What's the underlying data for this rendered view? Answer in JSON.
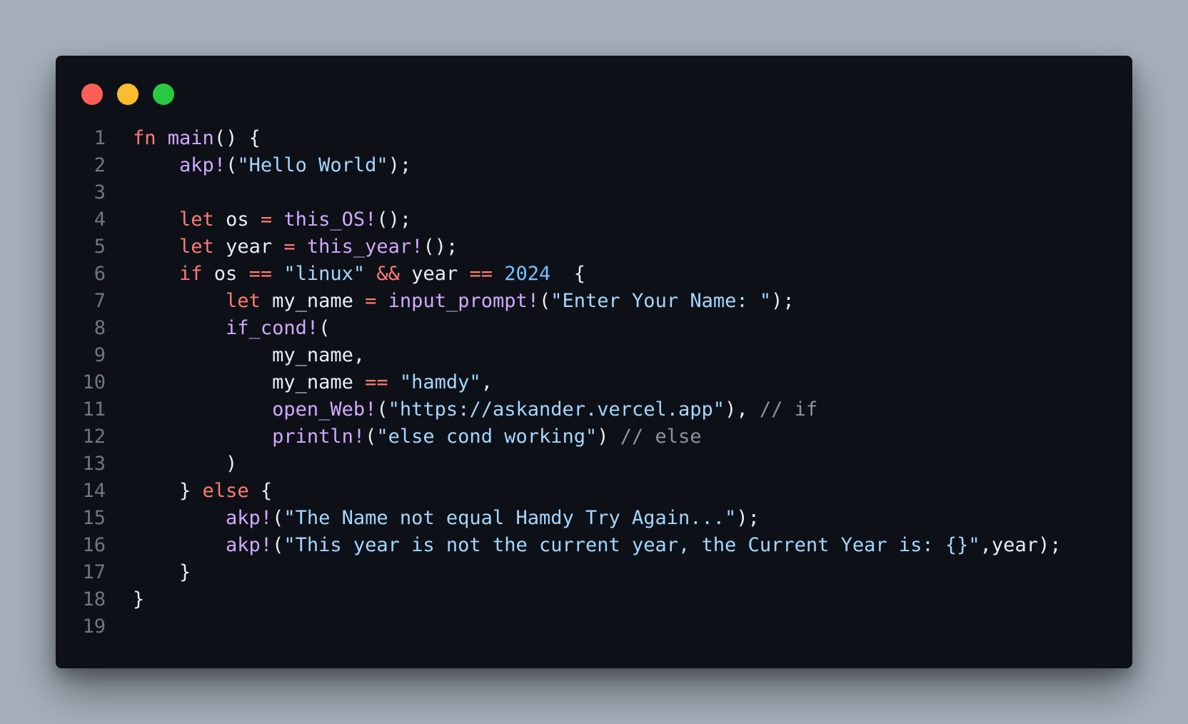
{
  "colors": {
    "background": "#a6b0bb",
    "window": "#0d1117",
    "line_number": "#6e7681",
    "keyword": "#ff7b72",
    "function": "#d2a8ff",
    "string": "#a5d6ff",
    "number": "#79c0ff",
    "comment": "#8b949e",
    "plain": "#e6edf3"
  },
  "window_controls": [
    {
      "name": "close-dot",
      "color": "#ff5f57"
    },
    {
      "name": "minimize-dot",
      "color": "#febc2e"
    },
    {
      "name": "zoom-dot",
      "color": "#28c840"
    }
  ],
  "lines": [
    {
      "n": "1",
      "tokens": [
        [
          "kw",
          "fn"
        ],
        [
          "pl",
          " "
        ],
        [
          "fn",
          "main"
        ],
        [
          "pl",
          "() {"
        ]
      ]
    },
    {
      "n": "2",
      "tokens": [
        [
          "pl",
          "    "
        ],
        [
          "fn",
          "akp!"
        ],
        [
          "pl",
          "("
        ],
        [
          "str",
          "\"Hello World\""
        ],
        [
          "pl",
          ");"
        ]
      ]
    },
    {
      "n": "3",
      "tokens": []
    },
    {
      "n": "4",
      "tokens": [
        [
          "pl",
          "    "
        ],
        [
          "kw",
          "let"
        ],
        [
          "pl",
          " os "
        ],
        [
          "op",
          "="
        ],
        [
          "pl",
          " "
        ],
        [
          "fn",
          "this_OS!"
        ],
        [
          "pl",
          "();"
        ]
      ]
    },
    {
      "n": "5",
      "tokens": [
        [
          "pl",
          "    "
        ],
        [
          "kw",
          "let"
        ],
        [
          "pl",
          " year "
        ],
        [
          "op",
          "="
        ],
        [
          "pl",
          " "
        ],
        [
          "fn",
          "this_year!"
        ],
        [
          "pl",
          "();"
        ]
      ]
    },
    {
      "n": "6",
      "tokens": [
        [
          "pl",
          "    "
        ],
        [
          "kw",
          "if"
        ],
        [
          "pl",
          " os "
        ],
        [
          "op",
          "=="
        ],
        [
          "pl",
          " "
        ],
        [
          "str",
          "\"linux\""
        ],
        [
          "pl",
          " "
        ],
        [
          "op",
          "&&"
        ],
        [
          "pl",
          " year "
        ],
        [
          "op",
          "=="
        ],
        [
          "pl",
          " "
        ],
        [
          "num",
          "2024"
        ],
        [
          "pl",
          "  {"
        ]
      ]
    },
    {
      "n": "7",
      "tokens": [
        [
          "pl",
          "        "
        ],
        [
          "kw",
          "let"
        ],
        [
          "pl",
          " my_name "
        ],
        [
          "op",
          "="
        ],
        [
          "pl",
          " "
        ],
        [
          "fn",
          "input_prompt!"
        ],
        [
          "pl",
          "("
        ],
        [
          "str",
          "\"Enter Your Name: \""
        ],
        [
          "pl",
          ");"
        ]
      ]
    },
    {
      "n": "8",
      "tokens": [
        [
          "pl",
          "        "
        ],
        [
          "fn",
          "if_cond!"
        ],
        [
          "pl",
          "("
        ]
      ]
    },
    {
      "n": "9",
      "tokens": [
        [
          "pl",
          "            my_name,"
        ]
      ]
    },
    {
      "n": "10",
      "tokens": [
        [
          "pl",
          "            my_name "
        ],
        [
          "op",
          "=="
        ],
        [
          "pl",
          " "
        ],
        [
          "str",
          "\"hamdy\""
        ],
        [
          "pl",
          ","
        ]
      ]
    },
    {
      "n": "11",
      "tokens": [
        [
          "pl",
          "            "
        ],
        [
          "fn",
          "open_Web!"
        ],
        [
          "pl",
          "("
        ],
        [
          "str",
          "\"https://askander.vercel.app\""
        ],
        [
          "pl",
          "), "
        ],
        [
          "cm",
          "// if"
        ]
      ]
    },
    {
      "n": "12",
      "tokens": [
        [
          "pl",
          "            "
        ],
        [
          "fn",
          "println!"
        ],
        [
          "pl",
          "("
        ],
        [
          "str",
          "\"else cond working\""
        ],
        [
          "pl",
          ") "
        ],
        [
          "cm",
          "// else"
        ]
      ]
    },
    {
      "n": "13",
      "tokens": [
        [
          "pl",
          "        )"
        ]
      ]
    },
    {
      "n": "14",
      "tokens": [
        [
          "pl",
          "    } "
        ],
        [
          "kw",
          "else"
        ],
        [
          "pl",
          " {"
        ]
      ]
    },
    {
      "n": "15",
      "tokens": [
        [
          "pl",
          "        "
        ],
        [
          "fn",
          "akp!"
        ],
        [
          "pl",
          "("
        ],
        [
          "str",
          "\"The Name not equal Hamdy Try Again...\""
        ],
        [
          "pl",
          ");"
        ]
      ]
    },
    {
      "n": "16",
      "tokens": [
        [
          "pl",
          "        "
        ],
        [
          "fn",
          "akp!"
        ],
        [
          "pl",
          "("
        ],
        [
          "str",
          "\"This year is not the current year, the Current Year is: {}\""
        ],
        [
          "pl",
          ",year);"
        ]
      ]
    },
    {
      "n": "17",
      "tokens": [
        [
          "pl",
          "    }"
        ]
      ]
    },
    {
      "n": "18",
      "tokens": [
        [
          "pl",
          "}"
        ]
      ]
    },
    {
      "n": "19",
      "tokens": []
    }
  ]
}
